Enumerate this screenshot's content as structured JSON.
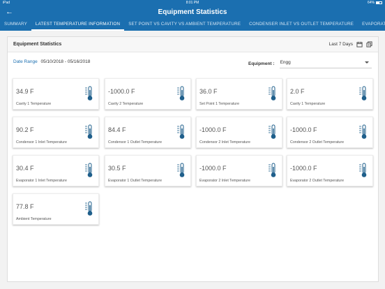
{
  "status_bar": {
    "device": "iPad",
    "time": "8:01 PM",
    "battery": "64%"
  },
  "header": {
    "back_icon": "back-arrow-icon",
    "title": "Equipment Statistics"
  },
  "tabs": [
    {
      "label": "SUMMARY",
      "active": false
    },
    {
      "label": "LATEST TEMPERATURE INFORMATION",
      "active": true
    },
    {
      "label": "SET POINT VS CAVITY VS AMBIENT TEMPERATURE",
      "active": false
    },
    {
      "label": "CONDENSER INLET VS OUTLET TEMPERATURE",
      "active": false
    },
    {
      "label": "EVAPORATO",
      "active": false
    }
  ],
  "panel": {
    "title": "Equipment Statistics",
    "period": "Last 7 Days",
    "date_range_label": "Date Range",
    "date_range_value": "05/10/2018 - 05/16/2018",
    "equipment_label": "Equipment :",
    "equipment_value": "Engg"
  },
  "cards": [
    {
      "value": "34.9 F",
      "label": "Cavity 1 Temperature"
    },
    {
      "value": "-1000.0 F",
      "label": "Cavity 2 Temperature"
    },
    {
      "value": "36.0 F",
      "label": "Set Point 1 Temperature"
    },
    {
      "value": "2.0 F",
      "label": "Cavity 1 Temperature"
    },
    {
      "value": "90.2 F",
      "label": "Condensor 1 Inlet Temperature"
    },
    {
      "value": "84.4 F",
      "label": "Condensor 1 Outlet Temperature"
    },
    {
      "value": "-1000.0 F",
      "label": "Condensor 2 Inlet Temperature"
    },
    {
      "value": "-1000.0 F",
      "label": "Condensor 2 Outlet Temperature"
    },
    {
      "value": "30.4 F",
      "label": "Evaporator 1 Inlet Temperature"
    },
    {
      "value": "30.5 F",
      "label": "Evaporator 1 Outlet Temperature"
    },
    {
      "value": "-1000.0 F",
      "label": "Evaporator 2 Inlet Temperature"
    },
    {
      "value": "-1000.0 F",
      "label": "Evaporator 2 Outlet Temperature"
    },
    {
      "value": "77.8 F",
      "label": "Ambient Temperature"
    }
  ],
  "colors": {
    "primary": "#1b6fb0",
    "thermometer": "#1f5f8b",
    "background": "#f2f2f2"
  }
}
